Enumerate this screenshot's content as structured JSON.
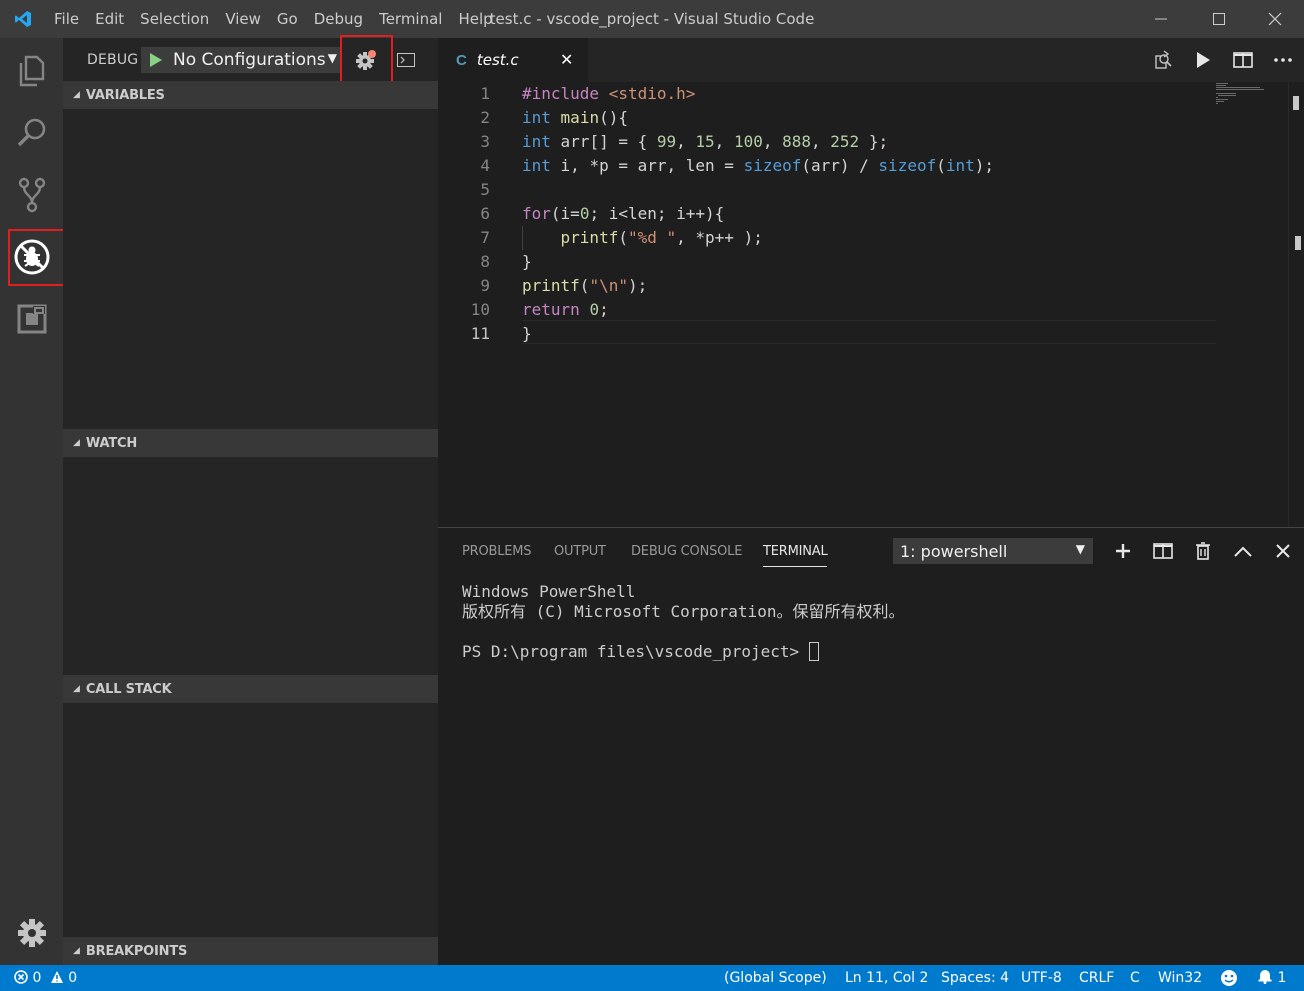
{
  "window": {
    "title": "test.c - vscode_project - Visual Studio Code",
    "menu": [
      "File",
      "Edit",
      "Selection",
      "View",
      "Go",
      "Debug",
      "Terminal",
      "Help"
    ]
  },
  "activity_bar": {
    "icons": [
      "explorer-icon",
      "search-icon",
      "source-control-icon",
      "debug-icon",
      "extensions-icon",
      "settings-gear-icon"
    ],
    "active": "debug-icon"
  },
  "debug": {
    "label": "DEBUG",
    "configuration": "No Configurations",
    "sections": [
      "VARIABLES",
      "WATCH",
      "CALL STACK",
      "BREAKPOINTS"
    ]
  },
  "editor": {
    "tab": {
      "lang_badge": "C",
      "label": "test.c",
      "close": "✕"
    },
    "active_line": 11,
    "lines": [
      {
        "n": "1",
        "tokens": [
          {
            "t": "#include ",
            "c": "ctl"
          },
          {
            "t": "<stdio.h>",
            "c": "str"
          }
        ]
      },
      {
        "n": "2",
        "tokens": [
          {
            "t": "int",
            "c": "kw"
          },
          {
            "t": " ",
            "c": ""
          },
          {
            "t": "main",
            "c": "fn"
          },
          {
            "t": "(){",
            "c": ""
          }
        ]
      },
      {
        "n": "3",
        "tokens": [
          {
            "t": "int",
            "c": "kw"
          },
          {
            "t": " arr[] = { ",
            "c": ""
          },
          {
            "t": "99",
            "c": "num"
          },
          {
            "t": ", ",
            "c": ""
          },
          {
            "t": "15",
            "c": "num"
          },
          {
            "t": ", ",
            "c": ""
          },
          {
            "t": "100",
            "c": "num"
          },
          {
            "t": ", ",
            "c": ""
          },
          {
            "t": "888",
            "c": "num"
          },
          {
            "t": ", ",
            "c": ""
          },
          {
            "t": "252",
            "c": "num"
          },
          {
            "t": " };",
            "c": ""
          }
        ]
      },
      {
        "n": "4",
        "tokens": [
          {
            "t": "int",
            "c": "kw"
          },
          {
            "t": " i, *p = arr, len = ",
            "c": ""
          },
          {
            "t": "sizeof",
            "c": "kw"
          },
          {
            "t": "(arr) / ",
            "c": ""
          },
          {
            "t": "sizeof",
            "c": "kw"
          },
          {
            "t": "(",
            "c": ""
          },
          {
            "t": "int",
            "c": "kw"
          },
          {
            "t": ");",
            "c": ""
          }
        ]
      },
      {
        "n": "5",
        "tokens": []
      },
      {
        "n": "6",
        "tokens": [
          {
            "t": "for",
            "c": "ctl"
          },
          {
            "t": "(i=",
            "c": ""
          },
          {
            "t": "0",
            "c": "num"
          },
          {
            "t": "; i<len; i++){",
            "c": ""
          }
        ]
      },
      {
        "n": "7",
        "tokens": [
          {
            "t": "    ",
            "c": ""
          },
          {
            "t": "printf",
            "c": "fn"
          },
          {
            "t": "(",
            "c": ""
          },
          {
            "t": "\"%d \"",
            "c": "str"
          },
          {
            "t": ", *p++ );",
            "c": ""
          }
        ]
      },
      {
        "n": "8",
        "tokens": [
          {
            "t": "}",
            "c": ""
          }
        ]
      },
      {
        "n": "9",
        "tokens": [
          {
            "t": "printf",
            "c": "fn"
          },
          {
            "t": "(",
            "c": ""
          },
          {
            "t": "\"\\n\"",
            "c": "str"
          },
          {
            "t": ");",
            "c": ""
          }
        ]
      },
      {
        "n": "10",
        "tokens": [
          {
            "t": "return",
            "c": "ctl"
          },
          {
            "t": " ",
            "c": ""
          },
          {
            "t": "0",
            "c": "num"
          },
          {
            "t": ";",
            "c": ""
          }
        ]
      },
      {
        "n": "11",
        "tokens": [
          {
            "t": "}",
            "c": ""
          }
        ]
      }
    ]
  },
  "panel": {
    "tabs": [
      "PROBLEMS",
      "OUTPUT",
      "DEBUG CONSOLE",
      "TERMINAL"
    ],
    "active_tab": "TERMINAL",
    "terminal_select": "1: powershell",
    "terminal_lines": [
      "Windows PowerShell",
      "版权所有 (C) Microsoft Corporation。保留所有权利。",
      "",
      "PS D:\\program files\\vscode_project> "
    ]
  },
  "status": {
    "errors": "0",
    "warnings": "0",
    "scope": "(Global Scope)",
    "position": "Ln 11, Col 2",
    "spaces": "Spaces: 4",
    "encoding": "UTF-8",
    "eol": "CRLF",
    "language": "C",
    "platform": "Win32",
    "notifications": "1"
  },
  "colors": {
    "accent": "#007acc",
    "highlight_box": "#e02020",
    "run_green": "#89d185",
    "gear_badge": "#f48771"
  }
}
